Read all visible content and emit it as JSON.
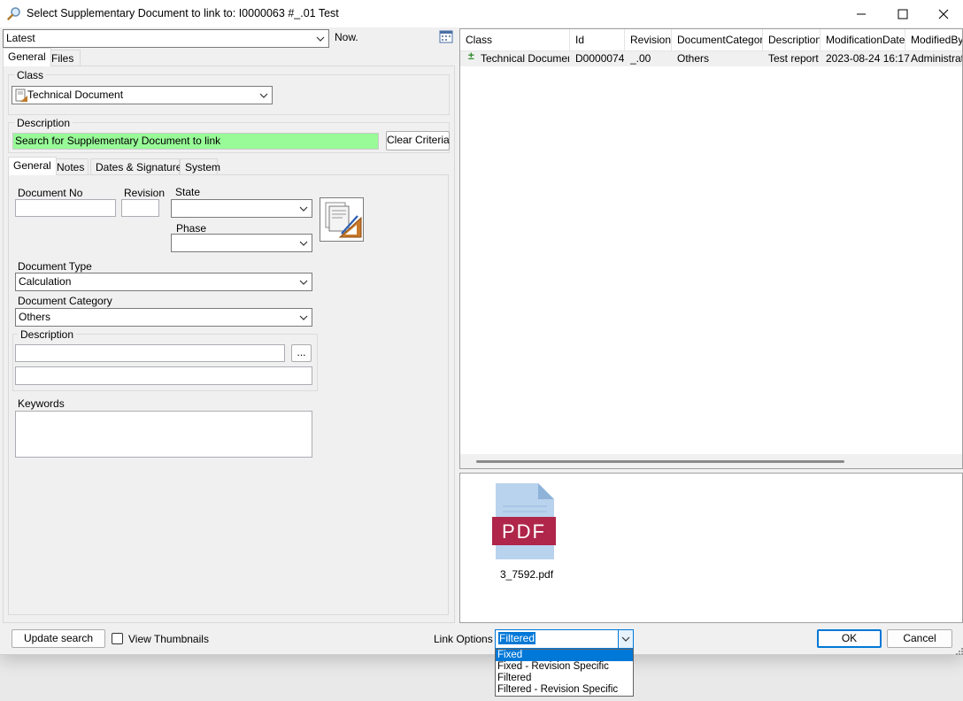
{
  "window": {
    "title": "Select Supplementary Document to link to: I0000063 #_.01 Test"
  },
  "top": {
    "version_value": "Latest",
    "now_label": "Now."
  },
  "outer_tabs": [
    "General",
    "Files"
  ],
  "class_group": {
    "title": "Class",
    "value": "Technical Document"
  },
  "description_group": {
    "title": "Description",
    "value": "Search for Supplementary Document to link",
    "clear_button": "Clear Criteria"
  },
  "inner_tabs": [
    "General",
    "Notes",
    "Dates & Signatures",
    "System"
  ],
  "form": {
    "document_no_label": "Document No",
    "revision_label": "Revision",
    "state_label": "State",
    "phase_label": "Phase",
    "document_type_label": "Document Type",
    "document_type_value": "Calculation",
    "document_category_label": "Document Category",
    "document_category_value": "Others",
    "description_label": "Description",
    "ellipsis_button": "...",
    "keywords_label": "Keywords"
  },
  "grid": {
    "columns": [
      "Class",
      "Id",
      "Revision",
      "DocumentCategory",
      "Description",
      "ModificationDate",
      "ModifiedBy"
    ],
    "rows": [
      {
        "expander": "±",
        "class": "Technical Document",
        "id": "D0000074",
        "revision": "_.00",
        "category": "Others",
        "description": "Test report",
        "modified": "2023-08-24 16:17",
        "modified_by": "Administrator"
      }
    ]
  },
  "preview": {
    "pdf_label": "PDF",
    "file_name": "3_7592.pdf"
  },
  "bottom": {
    "update_search": "Update search",
    "view_thumbnails": "View Thumbnails",
    "link_options_label": "Link Options",
    "link_options_value": "Filtered",
    "ok": "OK",
    "cancel": "Cancel"
  },
  "link_options_list": [
    "Fixed",
    "Fixed - Revision Specific",
    "Filtered",
    "Filtered - Revision Specific"
  ],
  "colors": {
    "search_highlight": "#98fb98",
    "selection": "#0078d7",
    "pdf_red": "#b0254a",
    "file_blue": "#b9d3ee"
  }
}
